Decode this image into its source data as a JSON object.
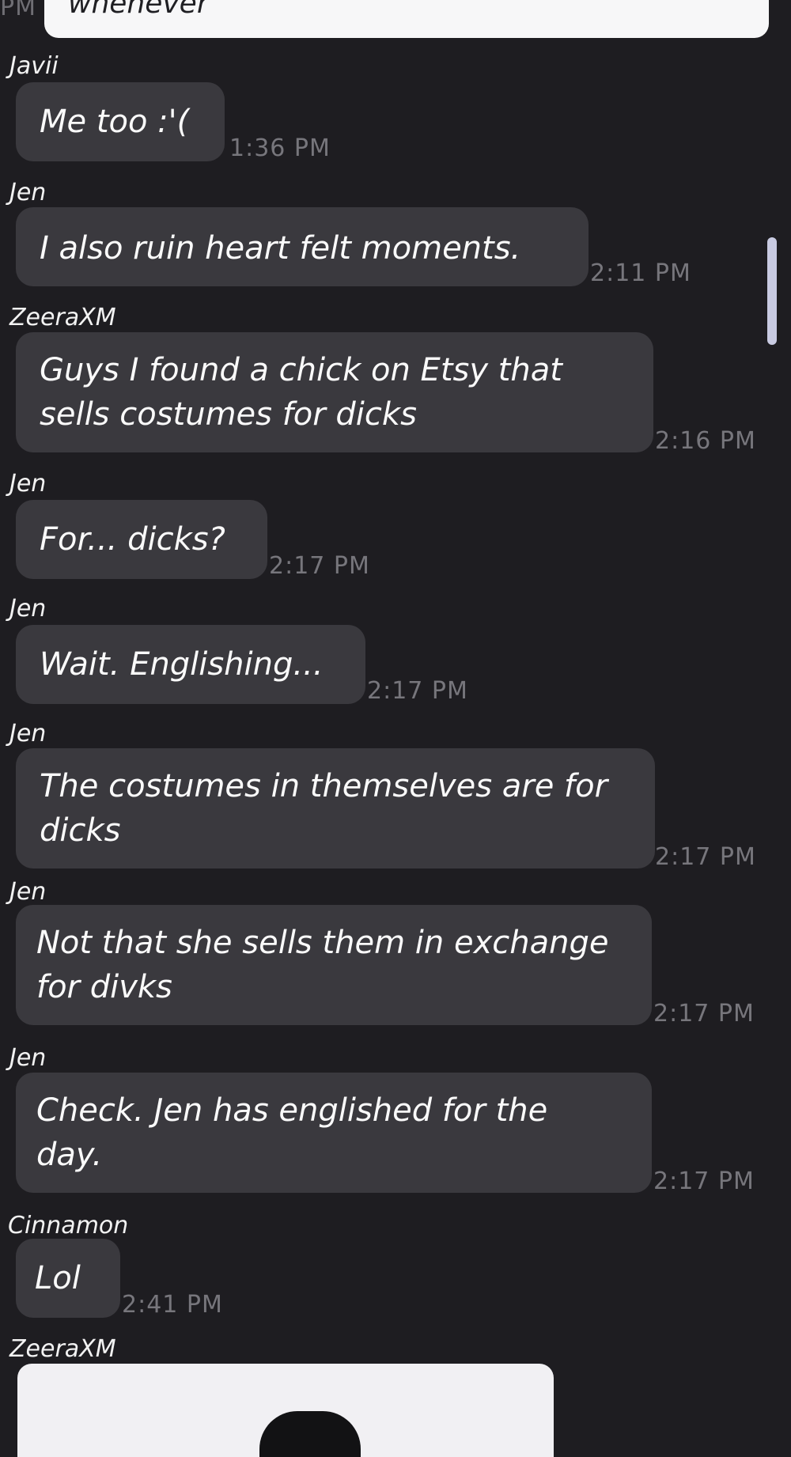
{
  "top": {
    "time_label": "PM",
    "previous_message_text": "whenever"
  },
  "messages": [
    {
      "sender": "Javii",
      "text": "Me too :'(",
      "time": "1:36 PM"
    },
    {
      "sender": "Jen",
      "text": "I also ruin heart felt moments.",
      "time": "2:11 PM"
    },
    {
      "sender": "ZeeraXM",
      "text": "Guys I found a chick on Etsy that sells costumes for dicks",
      "time": "2:16 PM"
    },
    {
      "sender": "Jen",
      "text": "For... dicks?",
      "time": "2:17 PM"
    },
    {
      "sender": "Jen",
      "text": "Wait. Englishing...",
      "time": "2:17 PM"
    },
    {
      "sender": "Jen",
      "text": "The costumes in themselves are for dicks",
      "time": "2:17 PM"
    },
    {
      "sender": "Jen",
      "text": "Not that she sells them in exchange for divks",
      "time": "2:17 PM"
    },
    {
      "sender": "Jen",
      "text": "Check. Jen has englished for the day.",
      "time": "2:17 PM"
    },
    {
      "sender": "Cinnamon",
      "text": "Lol",
      "time": "2:41 PM"
    }
  ],
  "last_message": {
    "sender": "ZeeraXM"
  },
  "colors": {
    "background": "#1e1d21",
    "bubble": "#3a393e",
    "timestamp": "#77767c",
    "scrollbar": "#c9cbe2",
    "image_bg": "#f1f0f3"
  }
}
